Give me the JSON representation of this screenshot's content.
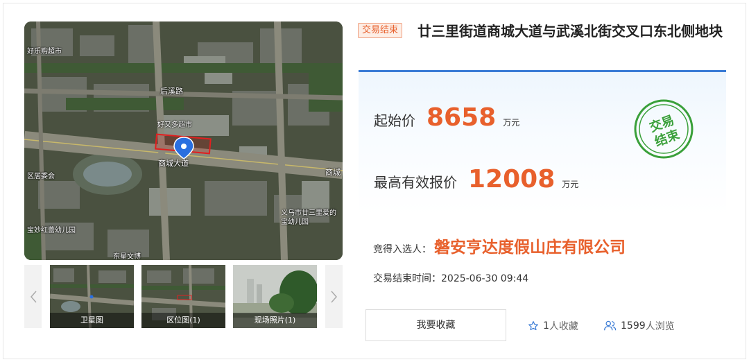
{
  "gallery": {
    "map_labels": {
      "label_1": "好乐购超市",
      "label_2": "后溪路",
      "label_3": "好又多超市",
      "label_4": "商城大道",
      "label_5": "商城",
      "label_6": "区居委会",
      "label_7": "宝妙红蕾幼儿园",
      "label_8": "义乌市廿三里爱的宝幼儿园",
      "label_9": "东星文博"
    },
    "thumbnails": [
      {
        "label": "卫星图"
      },
      {
        "label": "区位图(1)"
      },
      {
        "label": "现场照片(1)"
      }
    ]
  },
  "listing": {
    "status_tag": "交易结束",
    "title": "廿三里街道商城大道与武溪北街交叉口东北侧地块",
    "starting_price_label": "起始价",
    "starting_price_value": "8658",
    "starting_price_unit": "万元",
    "highest_bid_label": "最高有效报价",
    "highest_bid_value": "12008",
    "highest_bid_unit": "万元",
    "stamp_line1": "交易",
    "stamp_line2": "结束",
    "winner_label": "竞得入选人：",
    "winner_name": "磐安亨达度假山庄有限公司",
    "end_time_label": "交易结束时间：",
    "end_time_value": "2025-06-30 09:44"
  },
  "actions": {
    "favorite_button": "我要收藏",
    "favorites_count": "1",
    "favorites_suffix": "人收藏",
    "views_count": "1599",
    "views_suffix": "人浏览"
  },
  "colors": {
    "accent_orange": "#e8602c",
    "accent_blue": "#3a7bd5",
    "stamp_green": "#3aa03a"
  }
}
